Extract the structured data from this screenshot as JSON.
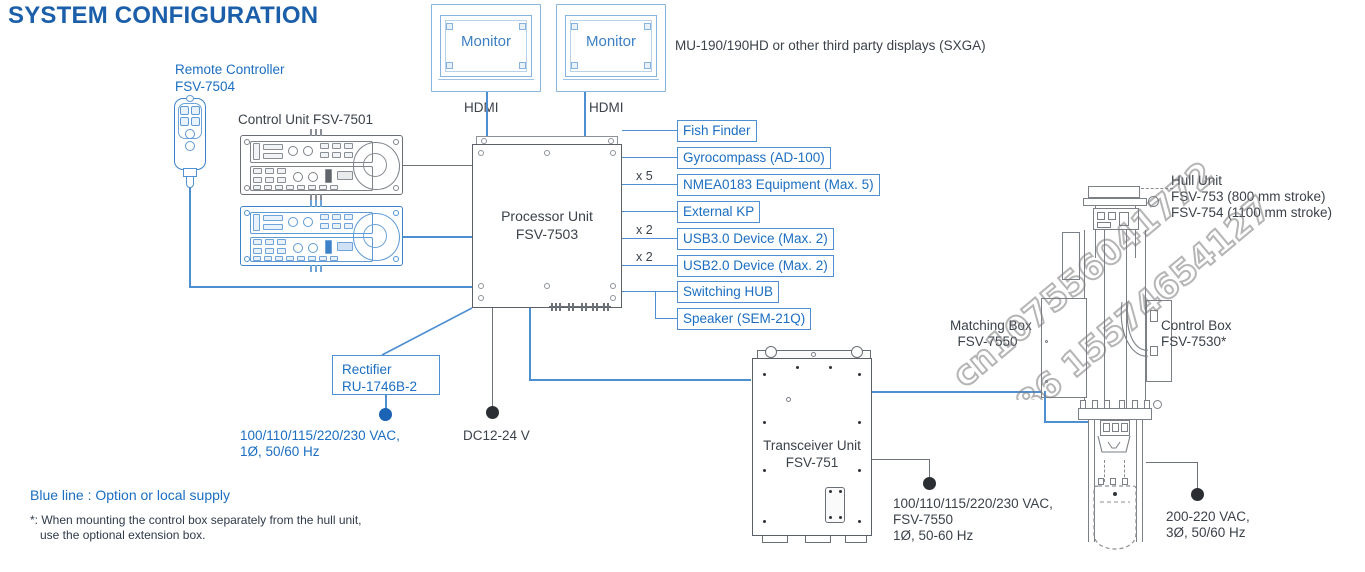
{
  "title": "SYSTEM CONFIGURATION",
  "monitors": [
    {
      "label": "Monitor",
      "port": "HDMI"
    },
    {
      "label": "Monitor",
      "port": "HDMI"
    }
  ],
  "monitor_note": "MU-190/190HD or other third party displays (SXGA)",
  "remote_controller": {
    "name": "Remote Controller",
    "model": "FSV-7504"
  },
  "control_unit": {
    "label": "Control Unit FSV-7501"
  },
  "processor_unit": {
    "name": "Processor Unit",
    "model": "FSV-7503"
  },
  "peripherals": [
    {
      "label": "Fish Finder",
      "multiplier": ""
    },
    {
      "label": "Gyrocompass (AD-100)",
      "multiplier": ""
    },
    {
      "label": "NMEA0183 Equipment (Max. 5)",
      "multiplier": "x 5"
    },
    {
      "label": "External KP",
      "multiplier": ""
    },
    {
      "label": "USB3.0 Device (Max. 2)",
      "multiplier": "x 2"
    },
    {
      "label": "USB2.0 Device (Max. 2)",
      "multiplier": "x 2"
    },
    {
      "label": "Switching HUB",
      "multiplier": ""
    },
    {
      "label": "Speaker (SEM-21Q)",
      "multiplier": ""
    }
  ],
  "rectifier": {
    "name": "Rectifier",
    "model": "RU-1746B-2"
  },
  "rectifier_power": "100/110/115/220/230 VAC,\n1Ø, 50/60 Hz",
  "dc_power": "DC12-24 V",
  "transceiver": {
    "name": "Transceiver Unit",
    "model": "FSV-751"
  },
  "transceiver_power": "100/110/115/220/230 VAC,\nFSV-7550\n1Ø, 50-60 Hz",
  "matching_box": "Matching Box\n  FSV-7550",
  "control_box": "Control Box\nFSV-7530*",
  "hull_unit": "Hull Unit\nFSV-753 (800 mm stroke)\nFSV-754 (1100 mm stroke)",
  "hull_power": "200-220 VAC,\n3Ø, 50/60 Hz",
  "legend": "Blue line : Option or local supply",
  "footnote": "*: When mounting the control box separately from the hull unit,\n   use the optional extension box.",
  "watermark": {
    "line1": "cn107556041772",
    "line2": "+86 15574654127"
  },
  "colors": {
    "blue": "#1b6ec2",
    "line_blue": "#4d8fd1",
    "dark": "#3b424a",
    "title": "#1b5faa"
  }
}
